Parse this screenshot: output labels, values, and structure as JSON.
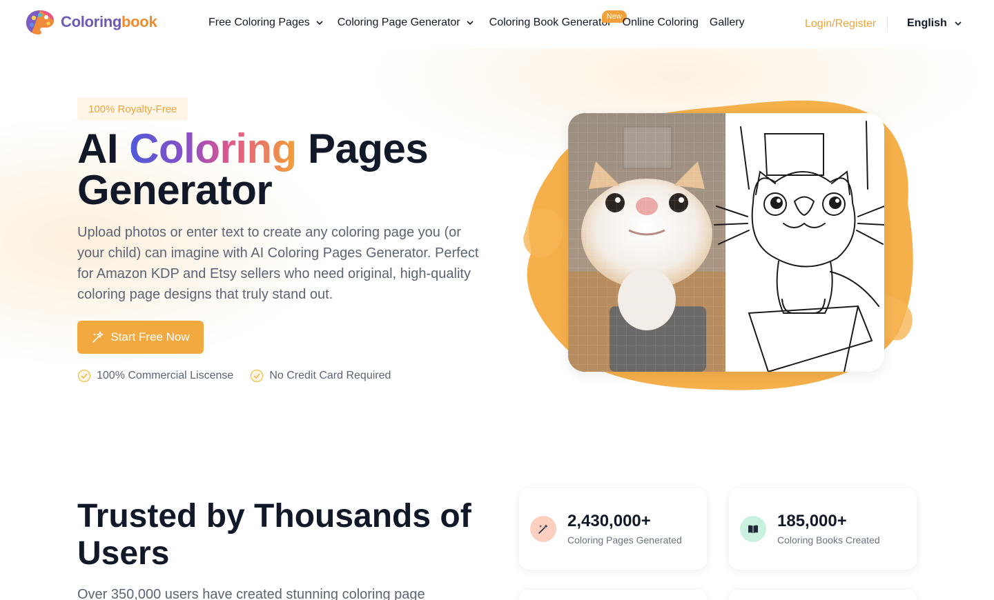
{
  "header": {
    "logo_part1": "Coloring",
    "logo_part2": "book",
    "nav": [
      {
        "label": "Free Coloring Pages",
        "has_dropdown": true
      },
      {
        "label": "Coloring Page Generator",
        "has_dropdown": true
      },
      {
        "label": "Coloring Book Generator",
        "has_dropdown": false,
        "badge": "New"
      },
      {
        "label": "Online Coloring",
        "has_dropdown": false
      },
      {
        "label": "Gallery",
        "has_dropdown": false
      }
    ],
    "login_label": "Login/Register",
    "language": "English"
  },
  "hero": {
    "badge": "100% Royalty-Free",
    "title_part1": "AI ",
    "title_highlight": "Coloring",
    "title_part2": " Pages",
    "title_line2": "Generator",
    "description": "Upload photos or enter text to create any coloring page you (or your child) can imagine with AI Coloring Pages Generator. Perfect for Amazon KDP and Etsy sellers who need original, high-quality coloring page designs that truly stand out.",
    "cta_label": "Start Free Now",
    "checks": [
      "100% Commercial Liscense",
      "No Credit Card Required"
    ]
  },
  "trusted": {
    "title": "Trusted by Thousands of Users",
    "subtitle": "Over 350,000 users have created stunning coloring page",
    "stats": [
      {
        "value": "2,430,000+",
        "label": "Coloring Pages Generated",
        "icon": "magic-wand-icon"
      },
      {
        "value": "185,000+",
        "label": "Coloring Books Created",
        "icon": "book-icon"
      }
    ]
  },
  "colors": {
    "accent": "#f2a93f",
    "login": "#eea43c",
    "title_gradient": [
      "#4f5ad9",
      "#8a4fc7",
      "#e0578a",
      "#f2a13a"
    ]
  }
}
